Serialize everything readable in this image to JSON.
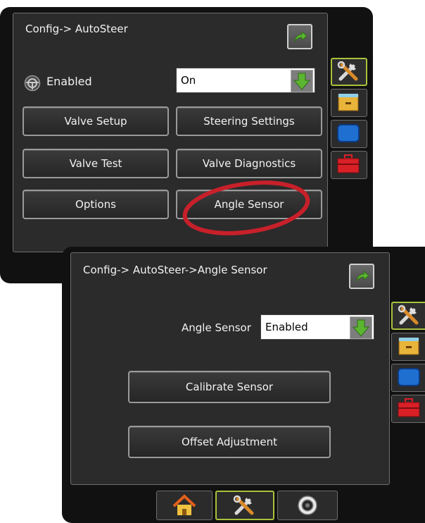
{
  "back_panel": {
    "title": "Config-> AutoSteer",
    "enabled_label": "Enabled",
    "enabled_value": "On",
    "buttons": {
      "valve_setup": "Valve Setup",
      "steering_settings": "Steering Settings",
      "valve_test": "Valve Test",
      "valve_diagnostics": "Valve Diagnostics",
      "options": "Options",
      "angle_sensor": "Angle Sensor"
    }
  },
  "front_panel": {
    "title": "Config-> AutoSteer->Angle Sensor",
    "angle_sensor_label": "Angle Sensor",
    "angle_sensor_value": "Enabled",
    "buttons": {
      "calibrate_sensor": "Calibrate Sensor",
      "offset_adjustment": "Offset Adjustment"
    }
  },
  "colors": {
    "highlight_circle": "#c8202a",
    "active_tab_border": "#a8c23c",
    "arrow_green": "#5bb531",
    "monitor_blue": "#1f6fd0",
    "toolbox_red": "#d92027",
    "box_yellow": "#e8b43a"
  },
  "icons": {
    "sidebar": [
      "tools-icon",
      "storage-box-icon",
      "monitor-icon",
      "toolbox-icon"
    ],
    "bottom": [
      "home-icon",
      "tools-icon",
      "camera-icon"
    ],
    "steering": "steering-wheel-icon",
    "back": "back-arrow-icon",
    "dropdown": "down-arrow-icon"
  }
}
